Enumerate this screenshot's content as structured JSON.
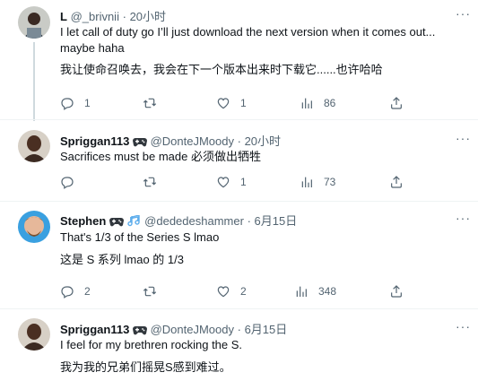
{
  "tweets": [
    {
      "name": "L",
      "handle": "@_brivnii",
      "dot": "·",
      "time": "20小时",
      "text1": "I let call of duty go I’ll just download the next version when it comes out... maybe haha",
      "text2": "我让使命召唤去，我会在下一个版本出来时下载它......也许哈哈",
      "reply_count": "1",
      "retweet_count": "",
      "like_count": "1",
      "view_count": "86",
      "more": "···"
    },
    {
      "name": "Spriggan113",
      "badge": "game-controller-emoji",
      "handle": "@DonteJMoody",
      "dot": "·",
      "time": "20小时",
      "text1": "Sacrifices must be made 必须做出牺牲",
      "reply_count": "",
      "retweet_count": "",
      "like_count": "1",
      "view_count": "73",
      "more": "···"
    },
    {
      "name": "Stephen",
      "badge": "game-controller-and-music-emoji",
      "handle": "@dededeshammer",
      "dot": "·",
      "time": "6月15日",
      "text1": "That's 1/3 of the Series S lmao",
      "text2": "这是 S 系列 lmao 的 1/3",
      "reply_count": "2",
      "retweet_count": "",
      "like_count": "2",
      "view_count": "348",
      "more": "···"
    },
    {
      "name": "Spriggan113",
      "badge": "game-controller-emoji",
      "handle": "@DonteJMoody",
      "dot": "·",
      "time": "6月15日",
      "text1": "I feel for my brethren rocking the S.",
      "text2": "我为我的兄弟们摇晃S感到难过。",
      "more": "···"
    }
  ],
  "colors": {
    "text": "#0f1419",
    "secondary": "#536471",
    "line": "#cfd9de"
  }
}
